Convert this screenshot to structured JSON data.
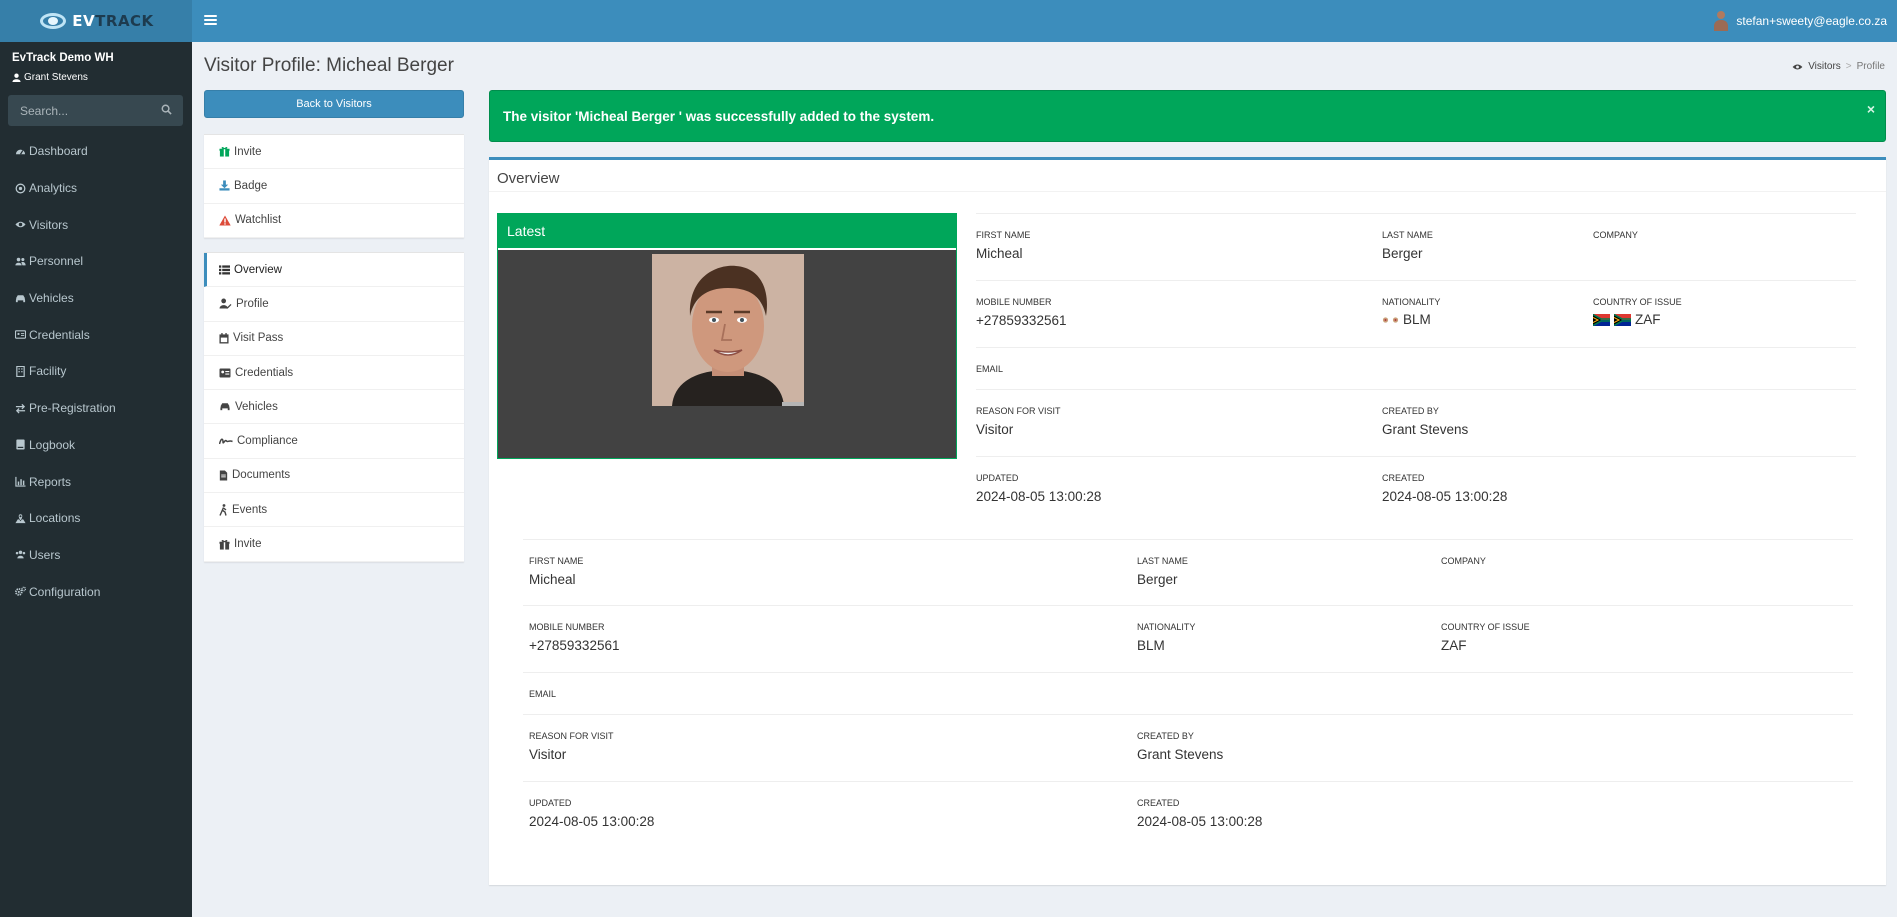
{
  "header": {
    "brand_ev": "EV",
    "brand_track": "TRACK",
    "user_email": "stefan+sweety@eagle.co.za"
  },
  "sidebar": {
    "company": "EvTrack Demo WH",
    "operator": "Grant Stevens",
    "search_placeholder": "Search...",
    "items": [
      {
        "label": "Dashboard",
        "icon": "dashboard-icon"
      },
      {
        "label": "Analytics",
        "icon": "analytics-icon"
      },
      {
        "label": "Visitors",
        "icon": "eye-icon"
      },
      {
        "label": "Personnel",
        "icon": "users-icon"
      },
      {
        "label": "Vehicles",
        "icon": "car-icon"
      },
      {
        "label": "Credentials",
        "icon": "id-card-icon"
      },
      {
        "label": "Facility",
        "icon": "building-icon"
      },
      {
        "label": "Pre-Registration",
        "icon": "exchange-icon"
      },
      {
        "label": "Logbook",
        "icon": "book-icon"
      },
      {
        "label": "Reports",
        "icon": "chart-icon"
      },
      {
        "label": "Locations",
        "icon": "map-icon"
      },
      {
        "label": "Users",
        "icon": "users-icon"
      },
      {
        "label": "Configuration",
        "icon": "gears-icon"
      }
    ]
  },
  "page": {
    "title": "Visitor Profile: Micheal Berger",
    "breadcrumb": {
      "visitors": "Visitors",
      "current": "Profile"
    },
    "back_button": "Back to Visitors"
  },
  "actions": [
    {
      "label": "Invite",
      "icon": "gift-icon",
      "color": "#00a65a"
    },
    {
      "label": "Badge",
      "icon": "download-icon",
      "color": "#3c8dbc"
    },
    {
      "label": "Watchlist",
      "icon": "warning-icon",
      "color": "#dd4b39"
    }
  ],
  "tabs": [
    {
      "label": "Overview",
      "icon": "list-icon",
      "active": true
    },
    {
      "label": "Profile",
      "icon": "user-edit-icon",
      "active": false
    },
    {
      "label": "Visit Pass",
      "icon": "calendar-icon",
      "active": false
    },
    {
      "label": "Credentials",
      "icon": "id-card-icon",
      "active": false
    },
    {
      "label": "Vehicles",
      "icon": "car-icon",
      "active": false
    },
    {
      "label": "Compliance",
      "icon": "signature-icon",
      "active": false
    },
    {
      "label": "Documents",
      "icon": "file-icon",
      "active": false
    },
    {
      "label": "Events",
      "icon": "walking-icon",
      "active": false
    },
    {
      "label": "Invite",
      "icon": "gift-icon",
      "active": false
    }
  ],
  "alert": {
    "message": "The visitor 'Micheal Berger ' was successfully added to the system.",
    "close": "×"
  },
  "overview": {
    "title": "Overview",
    "photo_title": "Latest",
    "labels": {
      "first_name": "FIRST NAME",
      "last_name": "LAST NAME",
      "company": "COMPANY",
      "mobile": "MOBILE NUMBER",
      "nationality": "NATIONALITY",
      "country_of_issue": "COUNTRY OF ISSUE",
      "email": "EMAIL",
      "reason": "REASON FOR VISIT",
      "created_by": "CREATED BY",
      "updated": "UPDATED",
      "created": "CREATED"
    },
    "values": {
      "first_name": "Micheal",
      "last_name": "Berger",
      "company": "",
      "mobile": "+27859332561",
      "nationality": "BLM",
      "country_of_issue": "ZAF",
      "email": "",
      "reason": "Visitor",
      "created_by": "Grant Stevens",
      "updated": "2024-08-05 13:00:28",
      "created": "2024-08-05 13:00:28"
    }
  },
  "colors": {
    "header": "#3c8dbc",
    "sidebar": "#222d32",
    "success": "#00a65a",
    "danger": "#dd4b39"
  }
}
